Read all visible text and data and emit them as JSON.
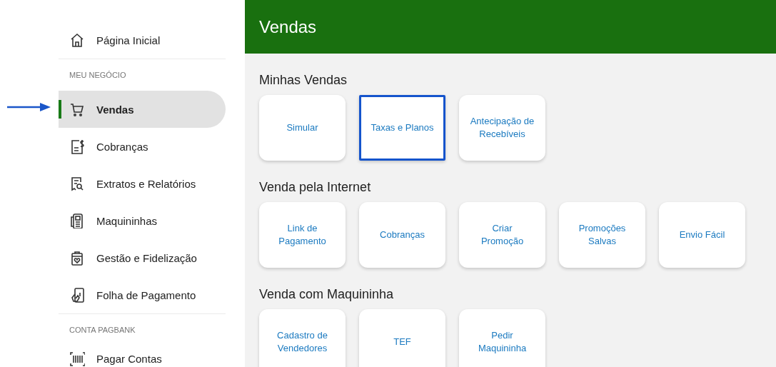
{
  "sidebar": {
    "groups": [
      {
        "items": [
          {
            "label": "Página Inicial",
            "selected": false
          }
        ]
      },
      {
        "title": "MEU NEGÓCIO",
        "items": [
          {
            "label": "Vendas",
            "selected": true
          },
          {
            "label": "Cobranças",
            "selected": false
          },
          {
            "label": "Extratos e Relatórios",
            "selected": false
          },
          {
            "label": "Maquininhas",
            "selected": false
          },
          {
            "label": "Gestão e Fidelização",
            "selected": false
          },
          {
            "label": "Folha de Pagamento",
            "selected": false
          }
        ]
      },
      {
        "title": "CONTA PAGBANK",
        "items": [
          {
            "label": "Pagar Contas",
            "selected": false
          }
        ]
      }
    ]
  },
  "header": {
    "title": "Vendas"
  },
  "sections": [
    {
      "title": "Minhas Vendas",
      "cards": [
        {
          "label": "Simular",
          "highlighted": false
        },
        {
          "label": "Taxas e Planos",
          "highlighted": true
        },
        {
          "label": "Antecipação de\nRecebíveis",
          "highlighted": false
        }
      ]
    },
    {
      "title": "Venda pela Internet",
      "cards": [
        {
          "label": "Link de\nPagamento",
          "highlighted": false
        },
        {
          "label": "Cobranças",
          "highlighted": false
        },
        {
          "label": "Criar\nPromoção",
          "highlighted": false
        },
        {
          "label": "Promoções\nSalvas",
          "highlighted": false
        },
        {
          "label": "Envio Fácil",
          "highlighted": false
        }
      ]
    },
    {
      "title": "Venda com Maquininha",
      "cards": [
        {
          "label": "Cadastro de\nVendedores",
          "highlighted": false
        },
        {
          "label": "TEF",
          "highlighted": false
        },
        {
          "label": "Pedir\nMaquininha",
          "highlighted": false
        }
      ]
    }
  ]
}
